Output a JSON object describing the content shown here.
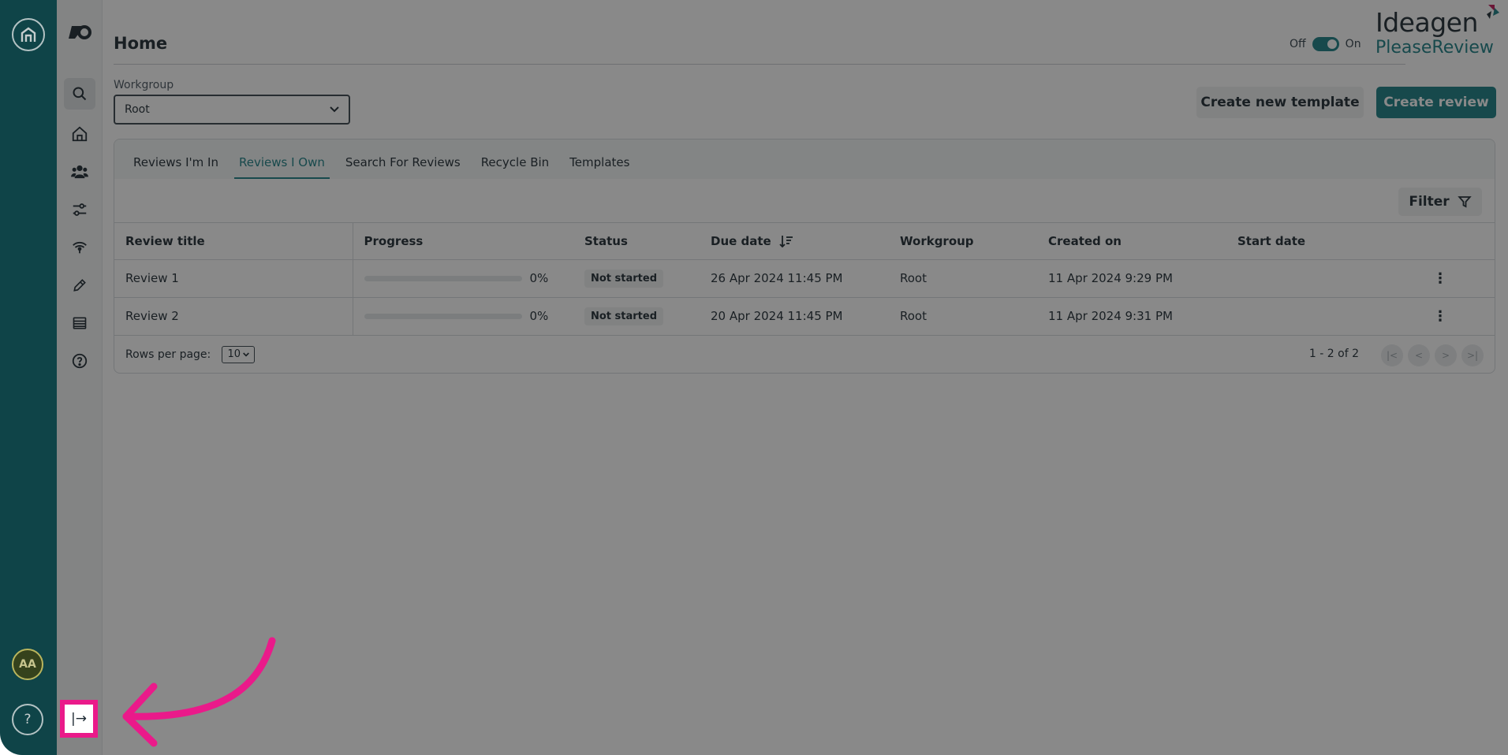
{
  "rail": {
    "avatar_initials": "AA",
    "help_label": "?"
  },
  "sidebar": {
    "items": [
      {
        "name": "search-icon",
        "active": true
      },
      {
        "name": "home-icon",
        "active": false
      },
      {
        "name": "users-icon",
        "active": false
      },
      {
        "name": "sliders-icon",
        "active": false
      },
      {
        "name": "broadcast-icon",
        "active": false
      },
      {
        "name": "pencil-icon",
        "active": false
      },
      {
        "name": "list-icon",
        "active": false
      },
      {
        "name": "help-circle-icon",
        "active": false
      }
    ],
    "expand_label": "|→"
  },
  "header": {
    "title": "Home",
    "toggle_off": "Off",
    "toggle_on": "On",
    "brand_top": "Ideagen",
    "brand_bottom": "PleaseReview"
  },
  "workgroup": {
    "label": "Workgroup",
    "value": "Root"
  },
  "actions": {
    "create_template": "Create new template",
    "create_review": "Create review"
  },
  "tabs": [
    {
      "label": "Reviews I'm In",
      "active": false
    },
    {
      "label": "Reviews I Own",
      "active": true
    },
    {
      "label": "Search For Reviews",
      "active": false
    },
    {
      "label": "Recycle Bin",
      "active": false
    },
    {
      "label": "Templates",
      "active": false
    }
  ],
  "filter_label": "Filter",
  "table": {
    "columns": [
      "Review title",
      "Progress",
      "Status",
      "Due date",
      "Workgroup",
      "Created on",
      "Start date"
    ],
    "rows": [
      {
        "title": "Review 1",
        "progress": 0,
        "progress_label": "0%",
        "status": "Not started",
        "due": "26 Apr 2024 11:45 PM",
        "workgroup": "Root",
        "created": "11 Apr 2024 9:29 PM",
        "start": ""
      },
      {
        "title": "Review 2",
        "progress": 0,
        "progress_label": "0%",
        "status": "Not started",
        "due": "20 Apr 2024 11:45 PM",
        "workgroup": "Root",
        "created": "11 Apr 2024 9:31 PM",
        "start": ""
      }
    ]
  },
  "pager": {
    "rows_per_page_label": "Rows per page:",
    "rows_per_page": "10",
    "range": "1 - 2 of 2"
  },
  "colors": {
    "rail": "#0f4d52",
    "accent": "#1a7f85",
    "highlight": "#ea1a8a"
  }
}
